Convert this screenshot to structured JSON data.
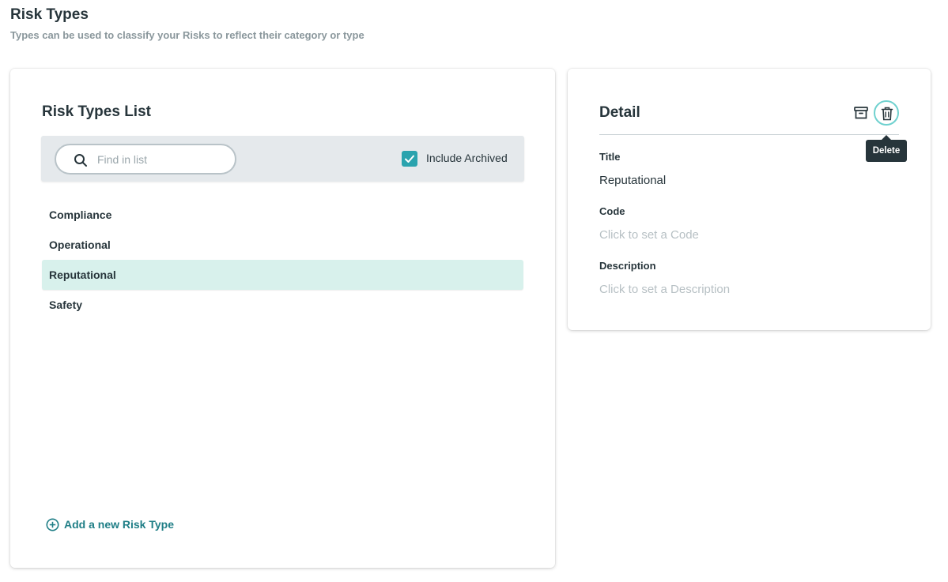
{
  "header": {
    "title": "Risk Types",
    "subtitle": "Types can be used to classify your Risks to reflect their category or type"
  },
  "list_panel": {
    "title": "Risk Types List",
    "search": {
      "placeholder": "Find in list",
      "value": ""
    },
    "include_archived": {
      "label": "Include Archived",
      "checked": true
    },
    "items": [
      {
        "label": "Compliance",
        "selected": false
      },
      {
        "label": "Operational",
        "selected": false
      },
      {
        "label": "Reputational",
        "selected": true
      },
      {
        "label": "Safety",
        "selected": false
      }
    ],
    "add_label": "Add a new Risk Type"
  },
  "detail_panel": {
    "title": "Detail",
    "tooltip": "Delete",
    "fields": {
      "title_label": "Title",
      "title_value": "Reputational",
      "code_label": "Code",
      "code_placeholder": "Click to set a Code",
      "description_label": "Description",
      "description_placeholder": "Click to set a Description"
    }
  },
  "icons": {
    "search": "search-icon",
    "check": "check-icon",
    "add": "plus-circle-icon",
    "archive": "archive-icon",
    "delete": "trash-icon"
  },
  "colors": {
    "accent": "#2aa3ae",
    "selected_row": "#d8f1ec",
    "link": "#1f7e86",
    "tooltip_bg": "#27353b"
  }
}
